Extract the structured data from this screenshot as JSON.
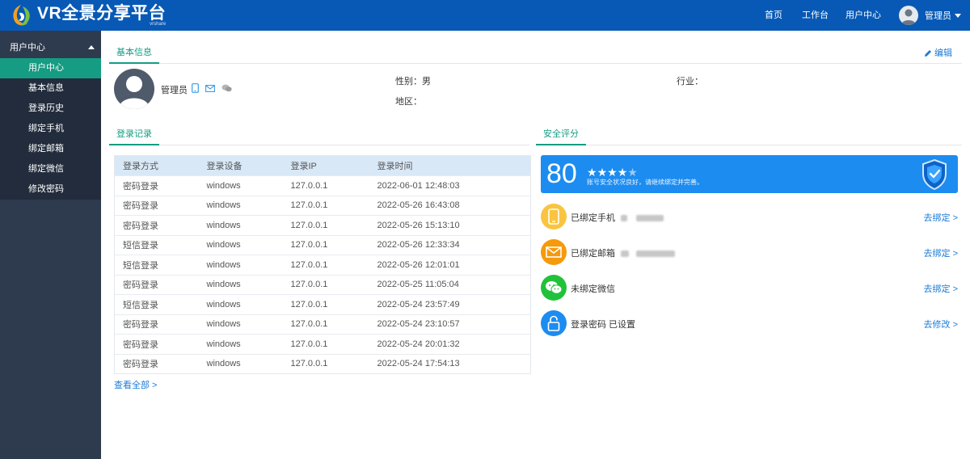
{
  "header": {
    "logo_text": "VR全景分享平台",
    "logo_sub": "vrshare",
    "nav": [
      "首页",
      "工作台",
      "用户中心"
    ],
    "user_name": "管理员"
  },
  "sidebar": {
    "group_label": "用户中心",
    "items": [
      {
        "label": "用户中心",
        "active": true
      },
      {
        "label": "基本信息"
      },
      {
        "label": "登录历史"
      },
      {
        "label": "绑定手机"
      },
      {
        "label": "绑定邮箱"
      },
      {
        "label": "绑定微信"
      },
      {
        "label": "修改密码"
      }
    ]
  },
  "basic_info": {
    "tab": "基本信息",
    "edit_label": "编辑",
    "username": "管理员",
    "gender_label": "性别：",
    "gender_value": "男",
    "industry_label": "行业：",
    "region_label": "地区："
  },
  "login_log": {
    "tab": "登录记录",
    "columns": [
      "登录方式",
      "登录设备",
      "登录IP",
      "登录时间"
    ],
    "rows": [
      [
        "密码登录",
        "windows",
        "127.0.0.1",
        "2022-06-01 12:48:03"
      ],
      [
        "密码登录",
        "windows",
        "127.0.0.1",
        "2022-05-26 16:43:08"
      ],
      [
        "密码登录",
        "windows",
        "127.0.0.1",
        "2022-05-26 15:13:10"
      ],
      [
        "短信登录",
        "windows",
        "127.0.0.1",
        "2022-05-26 12:33:34"
      ],
      [
        "短信登录",
        "windows",
        "127.0.0.1",
        "2022-05-26 12:01:01"
      ],
      [
        "密码登录",
        "windows",
        "127.0.0.1",
        "2022-05-25 11:05:04"
      ],
      [
        "短信登录",
        "windows",
        "127.0.0.1",
        "2022-05-24 23:57:49"
      ],
      [
        "密码登录",
        "windows",
        "127.0.0.1",
        "2022-05-24 23:10:57"
      ],
      [
        "密码登录",
        "windows",
        "127.0.0.1",
        "2022-05-24 20:01:32"
      ],
      [
        "密码登录",
        "windows",
        "127.0.0.1",
        "2022-05-24 17:54:13"
      ]
    ],
    "view_all": "查看全部 >"
  },
  "security": {
    "tab": "安全评分",
    "score": "80",
    "stars_filled": 4,
    "stars_total": 5,
    "desc": "账号安全状况良好，请继续绑定并完善。",
    "items": [
      {
        "text": "已绑定手机",
        "action": "去绑定 >",
        "color": "#f9c440",
        "icon": "phone-icon"
      },
      {
        "text": "已绑定邮箱",
        "action": "去绑定 >",
        "color": "#f59a0c",
        "icon": "mail-icon"
      },
      {
        "text": "未绑定微信",
        "action": "去绑定 >",
        "color": "#21c23a",
        "icon": "wechat-icon"
      },
      {
        "text": "登录密码 已设置",
        "action": "去修改 >",
        "color": "#1c8cf0",
        "icon": "lock-icon"
      }
    ]
  },
  "colors": {
    "header_bg": "#0759b5",
    "sidebar_bg": "#2e3a4e",
    "active_green": "#159c83",
    "link_blue": "#1b7bd6"
  }
}
